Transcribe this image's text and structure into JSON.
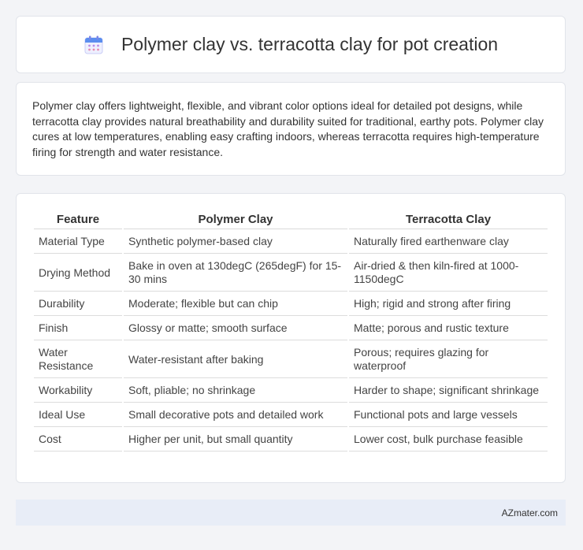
{
  "header": {
    "title": "Polymer clay vs. terracotta clay for pot creation",
    "icon": "calendar-icon"
  },
  "intro": {
    "text": "Polymer clay offers lightweight, flexible, and vibrant color options ideal for detailed pot designs, while terracotta clay provides natural breathability and durability suited for traditional, earthy pots. Polymer clay cures at low temperatures, enabling easy crafting indoors, whereas terracotta requires high-temperature firing for strength and water resistance."
  },
  "table": {
    "headers": [
      "Feature",
      "Polymer Clay",
      "Terracotta Clay"
    ],
    "rows": [
      [
        "Material Type",
        "Synthetic polymer-based clay",
        "Naturally fired earthenware clay"
      ],
      [
        "Drying Method",
        "Bake in oven at 130degC (265degF) for 15-30 mins",
        "Air-dried & then kiln-fired at 1000-1150degC"
      ],
      [
        "Durability",
        "Moderate; flexible but can chip",
        "High; rigid and strong after firing"
      ],
      [
        "Finish",
        "Glossy or matte; smooth surface",
        "Matte; porous and rustic texture"
      ],
      [
        "Water Resistance",
        "Water-resistant after baking",
        "Porous; requires glazing for waterproof"
      ],
      [
        "Workability",
        "Soft, pliable; no shrinkage",
        "Harder to shape; significant shrinkage"
      ],
      [
        "Ideal Use",
        "Small decorative pots and detailed work",
        "Functional pots and large vessels"
      ],
      [
        "Cost",
        "Higher per unit, but small quantity",
        "Lower cost, bulk purchase feasible"
      ]
    ]
  },
  "footer": {
    "brand": "AZmater.com"
  }
}
